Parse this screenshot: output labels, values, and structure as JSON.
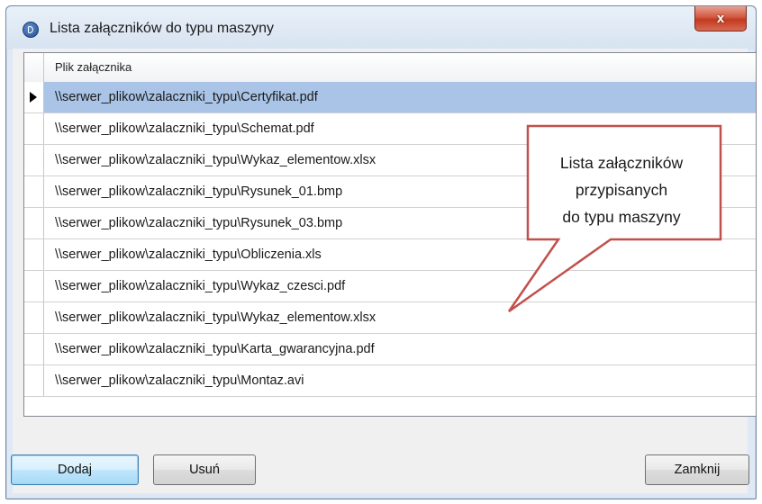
{
  "window": {
    "title": "Lista załączników do typu maszyny",
    "close_label": "x",
    "icon": "app-logo-icon"
  },
  "grid": {
    "column_header": "Plik załącznika",
    "rows": [
      "\\\\serwer_plikow\\zalaczniki_typu\\Certyfikat.pdf",
      "\\\\serwer_plikow\\zalaczniki_typu\\Schemat.pdf",
      "\\\\serwer_plikow\\zalaczniki_typu\\Wykaz_elementow.xlsx",
      "\\\\serwer_plikow\\zalaczniki_typu\\Rysunek_01.bmp",
      "\\\\serwer_plikow\\zalaczniki_typu\\Rysunek_03.bmp",
      "\\\\serwer_plikow\\zalaczniki_typu\\Obliczenia.xls",
      "\\\\serwer_plikow\\zalaczniki_typu\\Wykaz_czesci.pdf",
      "\\\\serwer_plikow\\zalaczniki_typu\\Wykaz_elementow.xlsx",
      "\\\\serwer_plikow\\zalaczniki_typu\\Karta_gwarancyjna.pdf",
      "\\\\serwer_plikow\\zalaczniki_typu\\Montaz.avi"
    ],
    "selected_index": 0
  },
  "callout": {
    "lines": [
      "Lista załączników",
      "przypisanych",
      "do typu maszyny"
    ],
    "border_color": "#c0504d"
  },
  "buttons": {
    "add": "Dodaj",
    "remove": "Usuń",
    "close": "Zamknij"
  },
  "colors": {
    "selection": "#a9c4e6",
    "window_frame": "#dfe9f5",
    "close_button": "#c23a20"
  }
}
